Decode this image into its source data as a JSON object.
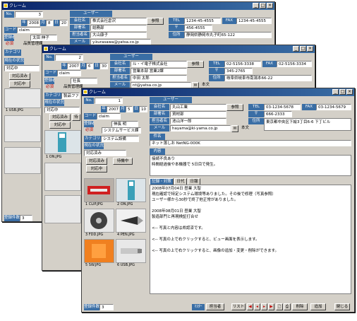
{
  "window": {
    "title": "クレーム"
  },
  "w1": {
    "no": "3",
    "year": "2008",
    "month": "8",
    "day": "20",
    "code": "claim",
    "labels": {
      "year": "年",
      "month": "月",
      "day": "日",
      "code": "コード",
      "registrar": "登録者",
      "req": "必須",
      "category": "カテゴリ",
      "status": "現在の状況"
    },
    "user_header": "ユーザー",
    "company_label": "会社名",
    "company": "株式会社倉沢",
    "dept_label": "部署名",
    "dept": "総務部",
    "person_label": "担当者名",
    "person": "大山康子",
    "mail_label": "メール",
    "mail": "y.kurasawa@yatsa.co.jp",
    "ref": "参照",
    "tel_label": "TEL",
    "tel": "1234-45-4555",
    "fax_label": "FAX",
    "fax": "1234-45-4555",
    "zip_label": "〒",
    "zip": "456-4555",
    "addr_label": "住所",
    "addr": "静岡県静岡市丸子町65-122",
    "registrar_val": "太田 伸子",
    "registrar_dept": "品質管理課",
    "status_val": "対応中",
    "btn_done": "対応済み",
    "btn_done2": "対",
    "count_label": "登録件数",
    "count": "3",
    "thumb1": "1 USB.JPG"
  },
  "w2": {
    "no": "2",
    "year": "2007",
    "month": "6",
    "day": "30",
    "code": "claim",
    "company": "ル・イ電子株式会社",
    "dept": "営業本部 営業2課",
    "person": "中田 太郎",
    "mail": "nt@yatsa.co.jp",
    "ref": "参照",
    "tel": "02-5156-3338",
    "fax": "02-5156-3334",
    "zip": "345-2765",
    "addr": "岐阜県岐阜市南湯本66-22",
    "registrar_val": "社長",
    "registrar_dept": "品質管理課",
    "category_val": "製品ファ",
    "status_val": "対応中",
    "btn_done": "対応済み",
    "btn_in": "対応中",
    "btn_wait": "待",
    "thumb1": "1 ON.JPG",
    "note": "本文"
  },
  "w3": {
    "no": "1",
    "year": "2007",
    "month": "5",
    "day": "10",
    "code": "claim",
    "company": "丸山工業",
    "dept": "資材部",
    "person": "池山洋一郎",
    "mail": "hayama@ki-yama.co.jp",
    "ref": "参照",
    "tel": "03-1234-5678",
    "fax": "03-1234-5679",
    "zip": "666-2333",
    "addr": "東京都中央区下絵3丁目6-6 下丁ビル",
    "registrar_val": "伸長 明",
    "registrar_dept": "システムサービス課",
    "category_val": "システム設備",
    "status_val": "対応済み",
    "btn_done": "対応済み",
    "btn_wait": "待機中",
    "btn_in": "対応中",
    "note": "本文",
    "subject_label": "件名",
    "subject": "ネット落しお NetNG-000K",
    "content_label": "内容",
    "content": [
      "接続不良あり",
      "時間経過後や本機器で 5日目で発生。"
    ],
    "tabs": [
      "記録・対策",
      "日代",
      "日報"
    ],
    "log": [
      "2008年07月04日 昼業 大智",
      "現在確認で特定システム環境等ありました。その後で修理（写真参照）",
      "ユーザー様から30秒で終了他正常がありました。",
      "",
      "2008年08月01日 昼業 大智",
      "製造部門と再現検証打合せ",
      "",
      "<-- 写真と内容は県認済です。",
      "",
      "<-- 写真の上で右クリックすると、ビュー画面を表示します。",
      "",
      "<-- 写真の上で右クリックすると、画像の追加・変更・削除ができます。"
    ],
    "thumbs": [
      "1 CLIP.JPG",
      "2 ON.JPG",
      "3 FDD.JPG",
      "4 PEN.JPG",
      "5 SW.JPG",
      "6 USB.JPG"
    ],
    "count_label": "登録件数",
    "count": "3",
    "toolbar": {
      "master": "ﾏｽﾀｰ",
      "person": "担当者",
      "list": "リスト",
      "new": "新規",
      "delete": "削除",
      "add": "追加",
      "close": "閉じる"
    }
  },
  "colors": {
    "titlebar": "#0a246a",
    "label": "#3a6ea5",
    "face": "#d4d0c8"
  }
}
